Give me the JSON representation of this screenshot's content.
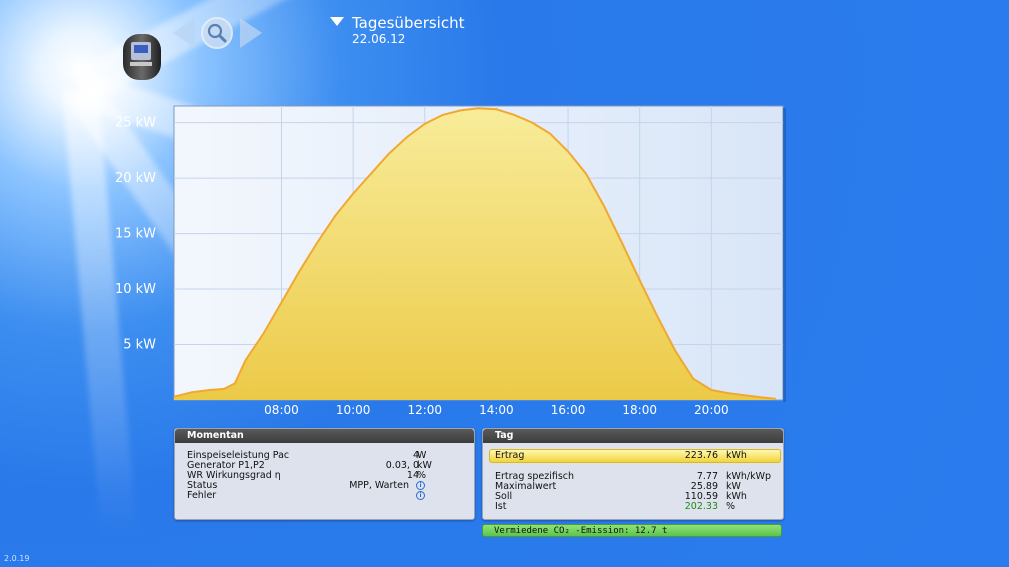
{
  "header": {
    "title": "Tagesübersicht",
    "date": "22.06.12"
  },
  "icons": {
    "device": "inverter-icon",
    "back": "chevron-left-icon",
    "search": "magnifier-icon",
    "forward": "chevron-right-icon"
  },
  "colors": {
    "background": "#2a7cee",
    "area_fill": "#f2d865",
    "area_stroke": "#f0a830",
    "plot_bg": "#e6eefb",
    "co2_green": "#5cc44a",
    "ist_green": "#1b8a1b"
  },
  "chart_data": {
    "type": "area",
    "title": "",
    "xlabel": "",
    "ylabel": "",
    "x_unit": "hours",
    "xlim": [
      5.0,
      22.0
    ],
    "ylim": [
      0,
      26.5
    ],
    "y_ticks": [
      5,
      10,
      15,
      20,
      25
    ],
    "y_tick_labels": [
      "5 kW",
      "10 kW",
      "15 kW",
      "20 kW",
      "25 kW"
    ],
    "x_ticks": [
      8,
      10,
      12,
      14,
      16,
      18,
      20
    ],
    "x_tick_labels": [
      "08:00",
      "10:00",
      "12:00",
      "14:00",
      "16:00",
      "18:00",
      "20:00"
    ],
    "grid": true,
    "series": [
      {
        "x": [
          5.0,
          5.5,
          6.0,
          6.4,
          6.7,
          7.0,
          7.5,
          8.0,
          8.5,
          9.0,
          9.5,
          10.0,
          10.5,
          11.0,
          11.5,
          12.0,
          12.5,
          13.0,
          13.5,
          14.0,
          14.5,
          15.0,
          15.5,
          16.0,
          16.5,
          17.0,
          17.5,
          18.0,
          18.5,
          19.0,
          19.5,
          20.0,
          20.5,
          21.0,
          21.5,
          21.8
        ],
        "values": [
          0.3,
          0.7,
          0.9,
          1.0,
          1.5,
          3.6,
          6.0,
          8.8,
          11.6,
          14.2,
          16.6,
          18.6,
          20.4,
          22.2,
          23.7,
          24.9,
          25.7,
          26.1,
          26.3,
          26.2,
          25.7,
          25.0,
          24.0,
          22.4,
          20.4,
          17.5,
          14.2,
          10.8,
          7.5,
          4.4,
          1.9,
          0.9,
          0.6,
          0.4,
          0.2,
          0.1
        ]
      }
    ]
  },
  "momentan": {
    "title": "Momentan",
    "rows": [
      {
        "label": "Einspeiseleistung Pac",
        "value": "4",
        "unit": "W"
      },
      {
        "label": "Generator P1,P2",
        "value": "0.03, 0",
        "unit": "kW"
      },
      {
        "label": "WR Wirkungsgrad η",
        "value": "14",
        "unit": "%"
      },
      {
        "label": "Status",
        "value": "MPP, Warten",
        "unit": ""
      },
      {
        "label": "Fehler",
        "value": "",
        "unit": ""
      }
    ]
  },
  "tag": {
    "title": "Tag",
    "ertrag": {
      "label": "Ertrag",
      "value": "223.76",
      "unit": "kWh"
    },
    "rows": [
      {
        "label": "Ertrag spezifisch",
        "value": "7.77",
        "unit": "kWh/kWp"
      },
      {
        "label": "Maximalwert",
        "value": "25.89",
        "unit": "kW"
      },
      {
        "label": "Soll",
        "value": "110.59",
        "unit": "kWh"
      },
      {
        "label": "Ist",
        "value": "202.33",
        "unit": "%"
      }
    ]
  },
  "co2": {
    "text": "Vermiedene CO₂ -Emission: 12.7 t"
  },
  "version": "2.0.19"
}
